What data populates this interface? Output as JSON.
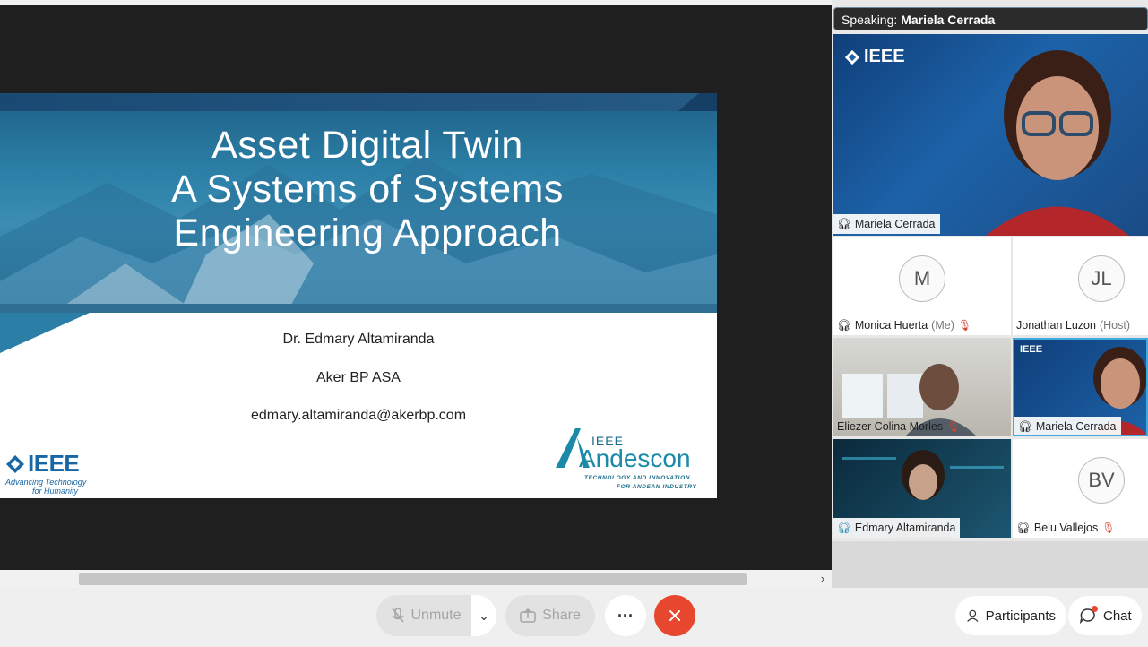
{
  "slide": {
    "title_lines": [
      "Asset Digital Twin",
      "A Systems of Systems",
      "Engineering Approach"
    ],
    "author": "Dr. Edmary Altamiranda",
    "company": "Aker BP ASA",
    "email": "edmary.altamiranda@akerbp.com",
    "ieee_wordmark": "IEEE",
    "ieee_tagline_1": "Advancing Technology",
    "ieee_tagline_2": "for Humanity",
    "andescon_top": "IEEE",
    "andescon_name": "Andescon",
    "andescon_sub_1": "TECHNOLOGY AND INNOVATION",
    "andescon_sub_2": "FOR ANDEAN INDUSTRY"
  },
  "speaking": {
    "prefix": "Speaking:",
    "name": "Mariela Cerrada"
  },
  "main_video": {
    "logo_text": "IEEE",
    "name": "Mariela Cerrada"
  },
  "participants": [
    {
      "name": "Monica Huerta",
      "suffix": "(Me)",
      "initials": "M"
    },
    {
      "name": "Jonathan Luzon",
      "suffix": "(Host)",
      "initials": "JL"
    },
    {
      "name": "Eliezer Colina Morles"
    },
    {
      "name": "Mariela Cerrada",
      "logo_text": "IEEE"
    },
    {
      "name": "Edmary Altamiranda"
    },
    {
      "name": "Belu Vallejos",
      "initials": "BV"
    }
  ],
  "toolbar": {
    "unmute": "Unmute",
    "share": "Share",
    "more": "···",
    "participants": "Participants",
    "chat": "Chat"
  },
  "colors": {
    "end_button": "#e8472f",
    "ieee_blue": "#1767a6",
    "andescon_teal": "#1a8aa8"
  }
}
